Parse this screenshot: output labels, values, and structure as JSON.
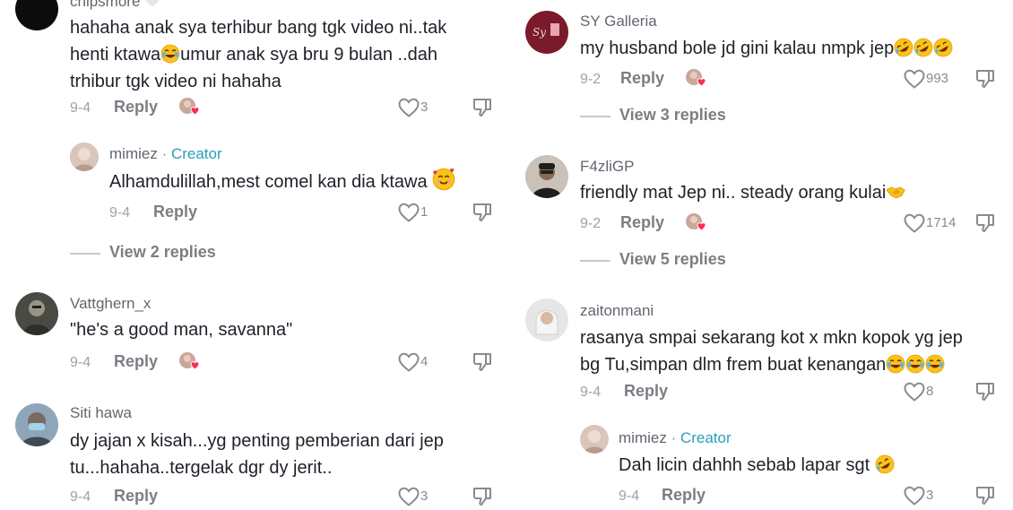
{
  "left": {
    "c1": {
      "username": "chipsmore",
      "lines": [
        "hahaha anak sya terhibur bang tgk video ni..tak",
        "henti ktawa",
        "umur anak sya bru 9 bulan ..dah",
        "trhibur tgk video ni hahaha"
      ],
      "date": "9-4",
      "reply": "Reply",
      "likes": "3"
    },
    "c1r": {
      "username": "mimiez",
      "dot": " · ",
      "creator": "Creator",
      "text": "Alhamdulillah,mest comel kan dia ktawa ",
      "date": "9-4",
      "reply": "Reply",
      "likes": "1"
    },
    "c1_view": "View 2 replies",
    "c2": {
      "username": "Vattghern_x",
      "text": "\"he's a good man, savanna\"",
      "date": "9-4",
      "reply": "Reply",
      "likes": "4"
    },
    "c3": {
      "username": "Siti hawa",
      "lines": [
        "dy jajan x kisah...yg penting pemberian dari jep",
        "tu...hahaha..tergelak dgr dy jerit.."
      ],
      "date": "9-4",
      "reply": "Reply",
      "likes": "3"
    }
  },
  "right": {
    "c1": {
      "username": "SY Galleria",
      "text": "my husband bole jd gini kalau nmpk jep",
      "date": "9-2",
      "reply": "Reply",
      "likes": "993"
    },
    "c1_view": "View 3 replies",
    "c2": {
      "username": "F4zliGP",
      "text": "friendly mat Jep ni.. steady orang kulai",
      "date": "9-2",
      "reply": "Reply",
      "likes": "1714"
    },
    "c2_view": "View 5 replies",
    "c3": {
      "username": "zaitonmani",
      "lines": [
        "rasanya smpai sekarang kot x mkn kopok yg jep",
        "bg Tu,simpan dlm frem buat kenangan"
      ],
      "date": "9-4",
      "reply": "Reply",
      "likes": "8"
    },
    "c3r": {
      "username": "mimiez",
      "dot": " · ",
      "creator": "Creator",
      "text": "Dah licin dahhh sebab lapar sgt ",
      "date": "9-4",
      "reply": "Reply",
      "likes": "3"
    }
  },
  "icons": {
    "like": "heart-outline-icon",
    "dislike": "thumbs-down-icon",
    "liked_by_creator": "creator-liked-avatar-icon",
    "emoji_laugh": "tears-of-joy-emoji",
    "emoji_rofl": "rolling-laughing-emoji",
    "emoji_love": "smiling-hearts-emoji",
    "emoji_handshake": "handshake-emoji"
  },
  "colors": {
    "creator": "#2a9fb8",
    "muted": "#8a8b91",
    "text": "#1f2029",
    "heart_badge": "#fe2c55"
  }
}
